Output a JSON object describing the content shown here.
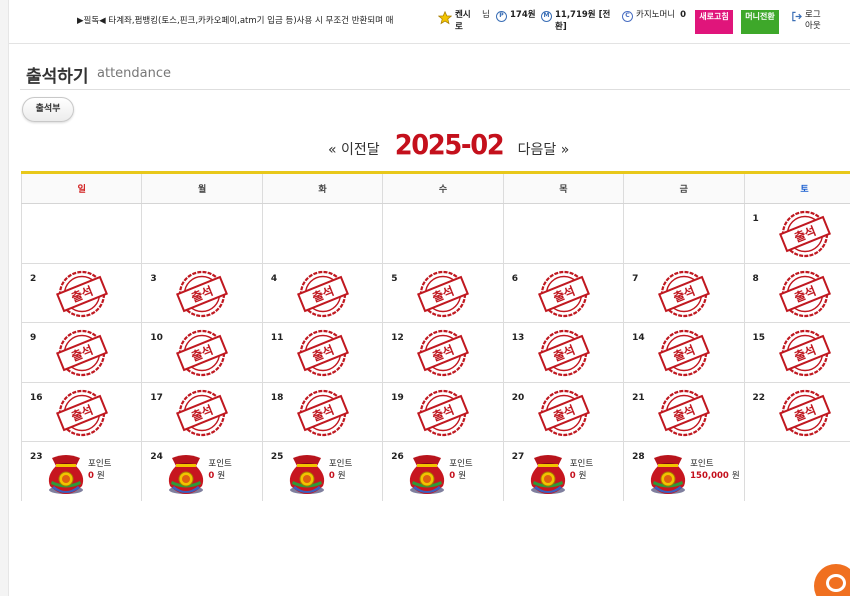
{
  "topbar": {
    "notice": "▶필독◀ 타계좌,펌뱅킹(토스,핀크,카카오페이,atm기 입금 등)사용 시 무조건 반환되며 매",
    "user_name": "켄시로",
    "user_suffix": "님",
    "points": "174원",
    "money": "11,719원 [전환]",
    "casino_money_label": "카지노머니",
    "casino_money_value": "0",
    "refresh_button": "새로고침",
    "money_convert_button": "머니전환",
    "logout": "로그아웃"
  },
  "page": {
    "title": "출석하기",
    "subtitle": "attendance",
    "attendance_book_button": "출석부"
  },
  "calendar": {
    "prev_label": "« 이전달",
    "month": "2025-02",
    "next_label": "다음달 »",
    "weekdays": [
      "일",
      "월",
      "화",
      "수",
      "목",
      "금",
      "토"
    ],
    "stamp_text": "출석",
    "point_label": "포인트",
    "weeks": [
      [
        {
          "day": ""
        },
        {
          "day": ""
        },
        {
          "day": ""
        },
        {
          "day": ""
        },
        {
          "day": ""
        },
        {
          "day": ""
        },
        {
          "day": "1",
          "stamp": true
        }
      ],
      [
        {
          "day": "2",
          "stamp": true
        },
        {
          "day": "3",
          "stamp": true
        },
        {
          "day": "4",
          "stamp": true
        },
        {
          "day": "5",
          "stamp": true
        },
        {
          "day": "6",
          "stamp": true
        },
        {
          "day": "7",
          "stamp": true
        },
        {
          "day": "8",
          "stamp": true
        }
      ],
      [
        {
          "day": "9",
          "stamp": true
        },
        {
          "day": "10",
          "stamp": true
        },
        {
          "day": "11",
          "stamp": true
        },
        {
          "day": "12",
          "stamp": true
        },
        {
          "day": "13",
          "stamp": true
        },
        {
          "day": "14",
          "stamp": true
        },
        {
          "day": "15",
          "stamp": true
        }
      ],
      [
        {
          "day": "16",
          "stamp": true
        },
        {
          "day": "17",
          "stamp": true
        },
        {
          "day": "18",
          "stamp": true
        },
        {
          "day": "19",
          "stamp": true
        },
        {
          "day": "20",
          "stamp": true
        },
        {
          "day": "21",
          "stamp": true
        },
        {
          "day": "22",
          "stamp": true
        }
      ],
      [
        {
          "day": "23",
          "points": "0",
          "unit": "원"
        },
        {
          "day": "24",
          "points": "0",
          "unit": "원"
        },
        {
          "day": "25",
          "points": "0",
          "unit": "원"
        },
        {
          "day": "26",
          "points": "0",
          "unit": "원"
        },
        {
          "day": "27",
          "points": "0",
          "unit": "원"
        },
        {
          "day": "28",
          "points": "150,000",
          "unit": "원"
        },
        {
          "day": ""
        }
      ]
    ]
  },
  "colors": {
    "accent_red": "#c4101c",
    "header_rule": "#e8c81a",
    "pink_button": "#e0157b",
    "green_button": "#3ea82a",
    "chat_orange": "#f07020"
  }
}
